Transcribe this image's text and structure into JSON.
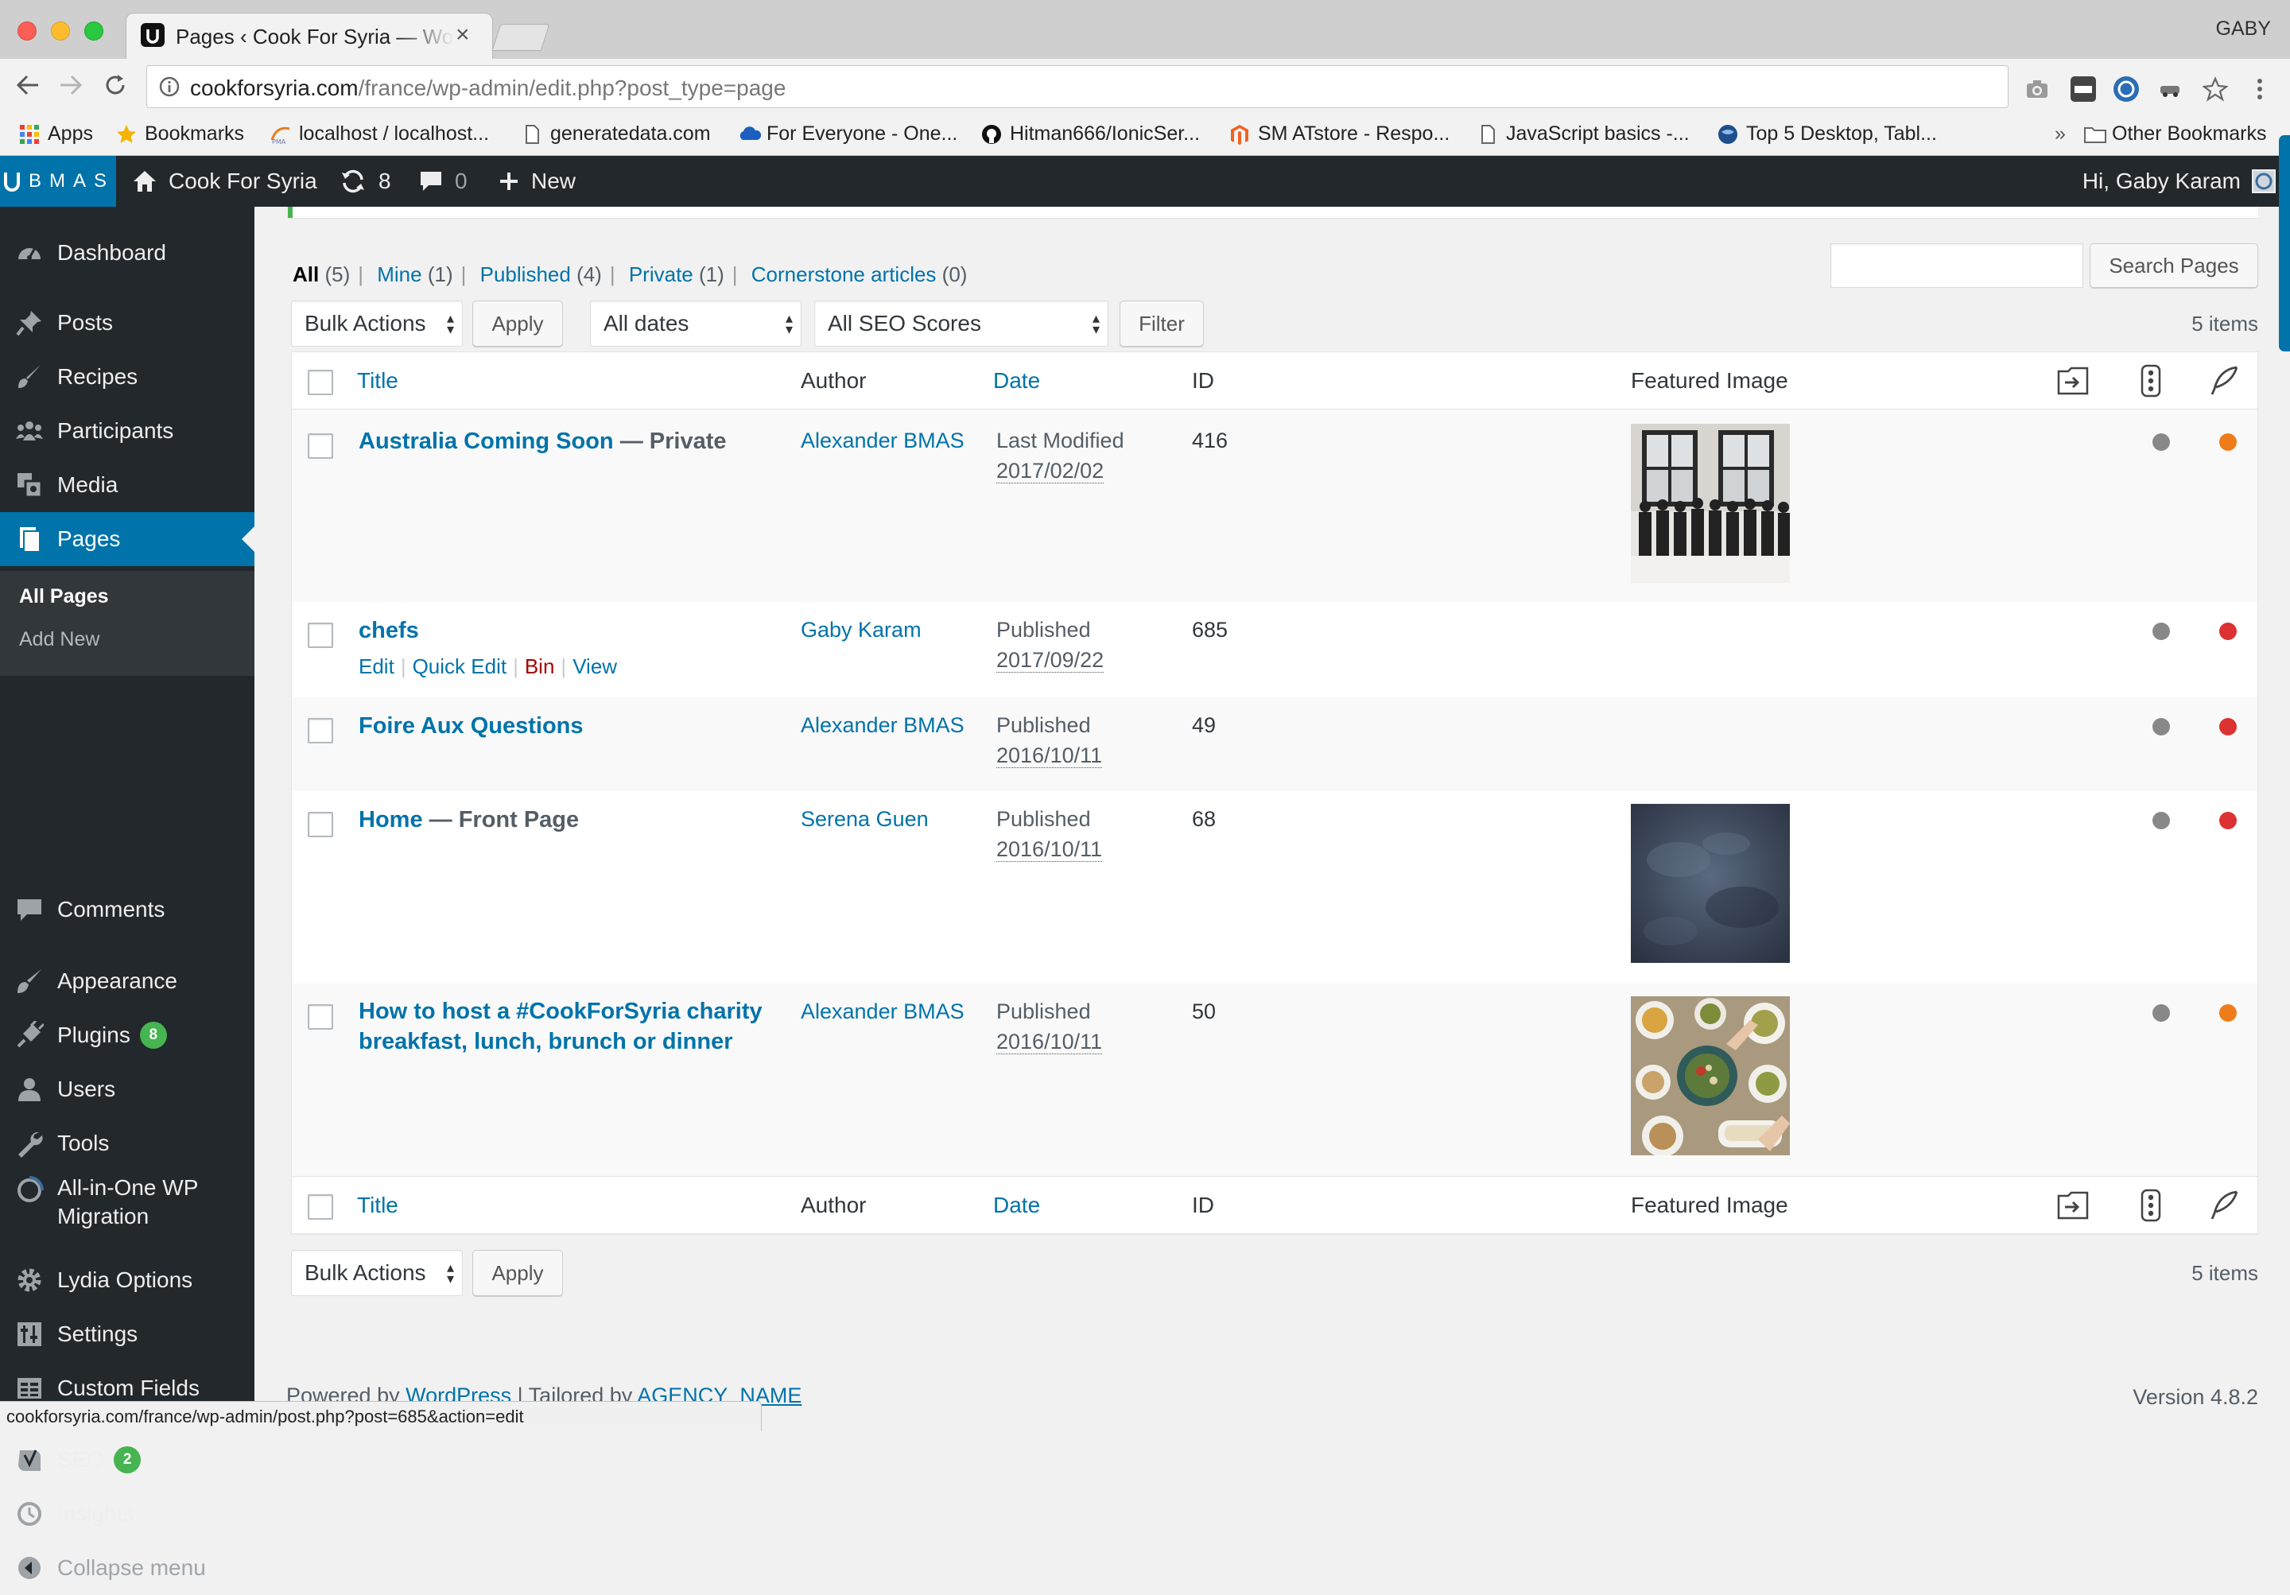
{
  "browser": {
    "tab_title": "Pages ‹ Cook For Syria — WordPress",
    "tab_close": "×",
    "profile_name": "GABY",
    "url_host": "cookforsyria.com",
    "url_path": "/france/wp-admin/edit.php?post_type=page",
    "bookmarks": [
      {
        "label": "Apps",
        "icon": "apps-grid-icon"
      },
      {
        "label": "Bookmarks",
        "icon": "star-icon"
      },
      {
        "label": "localhost / localhost...",
        "icon": "phpmyadmin-icon"
      },
      {
        "label": "generatedata.com",
        "icon": "page-icon"
      },
      {
        "label": "For Everyone - One...",
        "icon": "cloud-icon"
      },
      {
        "label": "Hitman666/IonicSer...",
        "icon": "github-icon"
      },
      {
        "label": "SM ATstore - Respo...",
        "icon": "magento-icon"
      },
      {
        "label": "JavaScript basics -...",
        "icon": "page-icon"
      },
      {
        "label": "Top 5 Desktop, Tabl...",
        "icon": "globe-icon"
      }
    ],
    "bookmarks_overflow": "»",
    "other_bookmarks": "Other Bookmarks",
    "status_url": "cookforsyria.com/france/wp-admin/post.php?post=685&action=edit"
  },
  "adminbar": {
    "logo_text": "BMAS",
    "site_name": "Cook For Syria",
    "updates_count": "8",
    "comments_count": "0",
    "new_label": "New",
    "greeting": "Hi, Gaby Karam"
  },
  "sidebar": {
    "items": [
      {
        "label": "Dashboard",
        "icon": "dashboard-icon"
      },
      {
        "label": "Posts",
        "icon": "pushpin-icon"
      },
      {
        "label": "Recipes",
        "icon": "brush-icon"
      },
      {
        "label": "Participants",
        "icon": "groups-icon"
      },
      {
        "label": "Media",
        "icon": "media-icon"
      },
      {
        "label": "Pages",
        "icon": "pages-icon"
      },
      {
        "label": "Comments",
        "icon": "comment-icon"
      },
      {
        "label": "Appearance",
        "icon": "paintbrush-icon"
      },
      {
        "label": "Plugins",
        "icon": "plugin-icon",
        "badge": "8"
      },
      {
        "label": "Users",
        "icon": "user-icon"
      },
      {
        "label": "Tools",
        "icon": "wrench-icon"
      },
      {
        "label": "All-in-One WP Migration",
        "icon": "migration-icon"
      },
      {
        "label": "Lydia Options",
        "icon": "gear-icon"
      },
      {
        "label": "Settings",
        "icon": "settings-sliders-icon"
      },
      {
        "label": "Custom Fields",
        "icon": "table-icon"
      },
      {
        "label": "SEO",
        "icon": "yoast-icon",
        "badge": "2"
      },
      {
        "label": "Insights",
        "icon": "insights-icon"
      },
      {
        "label": "Collapse menu",
        "icon": "collapse-icon"
      }
    ],
    "submenu": [
      "All Pages",
      "Add New"
    ]
  },
  "views": {
    "all": "All",
    "all_count": "(5)",
    "mine": "Mine",
    "mine_count": "(1)",
    "published": "Published",
    "published_count": "(4)",
    "private": "Private",
    "private_count": "(1)",
    "cornerstone": "Cornerstone articles",
    "cornerstone_count": "(0)",
    "sep": "|"
  },
  "search_button": "Search Pages",
  "filters": {
    "bulk_actions": "Bulk Actions",
    "apply": "Apply",
    "dates": "All dates",
    "seo_scores": "All SEO Scores",
    "filter": "Filter",
    "items_count": "5 items"
  },
  "columns": {
    "title": "Title",
    "author": "Author",
    "date": "Date",
    "id": "ID",
    "featured_image": "Featured Image"
  },
  "rows": [
    {
      "title": "Australia Coming Soon",
      "state": " — Private",
      "author": "Alexander BMAS",
      "date_status": "Last Modified",
      "date": "2017/02/02",
      "id": "416",
      "image": "team-photo",
      "seo_dot": "gray",
      "readability_dot": "orange"
    },
    {
      "title": "chefs",
      "state": "",
      "author": "Gaby Karam",
      "date_status": "Published",
      "date": "2017/09/22",
      "id": "685",
      "image": "",
      "seo_dot": "gray",
      "readability_dot": "red",
      "actions": {
        "edit": "Edit",
        "quick_edit": "Quick Edit",
        "bin": "Bin",
        "view": "View",
        "sep": "|"
      }
    },
    {
      "title": "Foire Aux Questions",
      "state": "",
      "author": "Alexander BMAS",
      "date_status": "Published",
      "date": "2016/10/11",
      "id": "49",
      "image": "",
      "seo_dot": "gray",
      "readability_dot": "red"
    },
    {
      "title": "Home",
      "state": " — Front Page",
      "author": "Serena Guen",
      "date_status": "Published",
      "date": "2016/10/11",
      "id": "68",
      "image": "slate-texture",
      "seo_dot": "gray",
      "readability_dot": "red"
    },
    {
      "title": "How to host a #CookForSyria charity breakfast, lunch, brunch or dinner",
      "state": "",
      "author": "Alexander BMAS",
      "date_status": "Published",
      "date": "2016/10/11",
      "id": "50",
      "image": "food-table",
      "seo_dot": "gray",
      "readability_dot": "orange"
    }
  ],
  "footer": {
    "powered_by": "Powered by",
    "wordpress": "WordPress",
    "tailored": " | Tailored by",
    "agency": "AGENCY_NAME",
    "version": "Version 4.8.2"
  },
  "colors": {
    "accent": "#0073aa",
    "sidebar_bg": "#23282d",
    "seo_gray": "#888888",
    "seo_orange": "#ee7c1b",
    "seo_red": "#dc3232",
    "badge_green": "#46b450"
  }
}
